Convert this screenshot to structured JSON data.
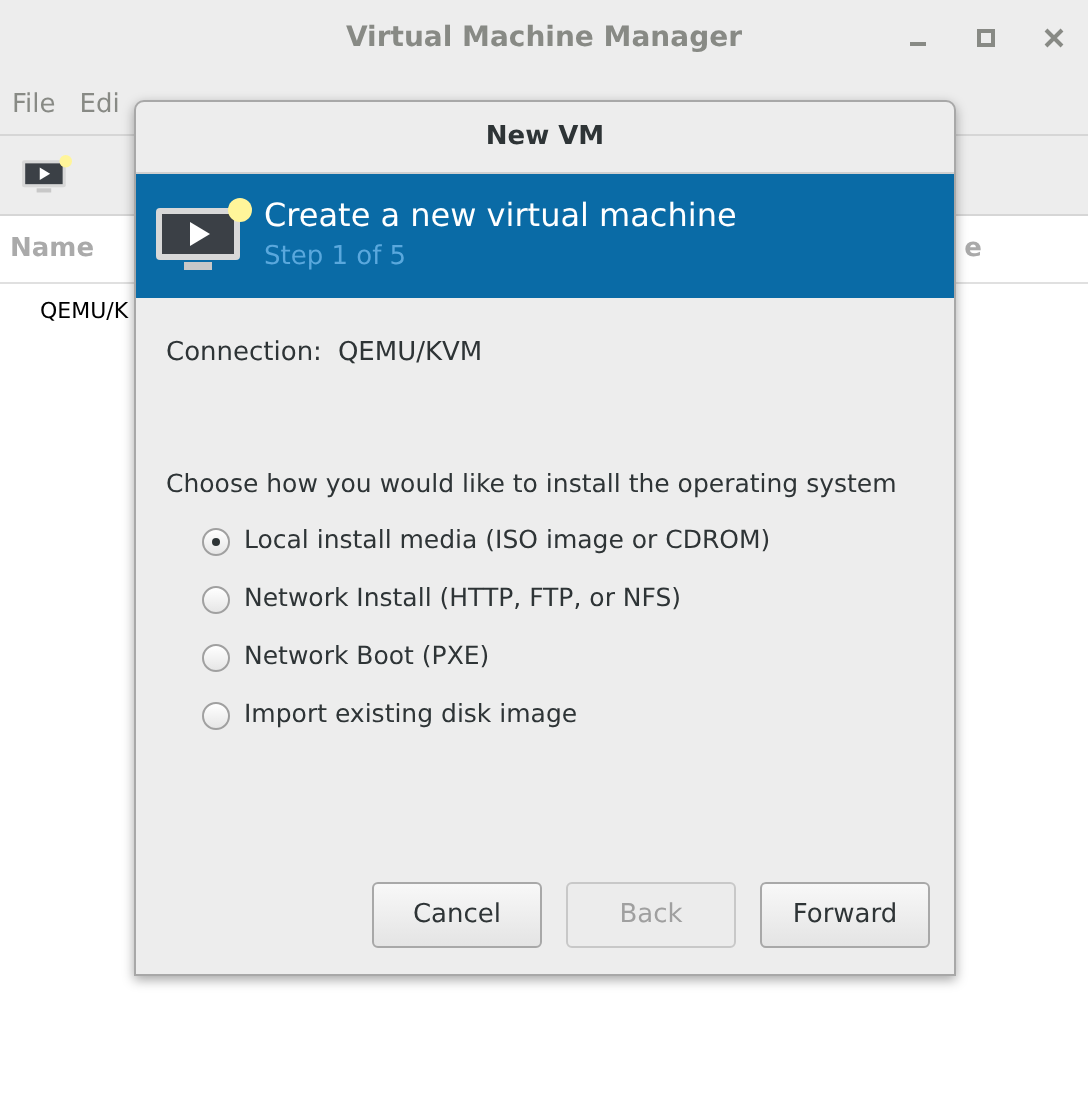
{
  "window": {
    "title": "Virtual Machine Manager"
  },
  "menu": [
    "File",
    "Edi"
  ],
  "table": {
    "columns": [
      "Name",
      "e"
    ],
    "rows": [
      "QEMU/K"
    ]
  },
  "dialog": {
    "title": "New VM",
    "heading": "Create a new virtual machine",
    "step": "Step 1 of 5",
    "connection_label": "Connection:",
    "connection_value": "QEMU/KVM",
    "prompt": "Choose how you would like to install the operating system",
    "options": [
      {
        "label": "Local install media (ISO image or CDROM)",
        "selected": true
      },
      {
        "label": "Network Install (HTTP, FTP, or NFS)",
        "selected": false
      },
      {
        "label": "Network Boot (PXE)",
        "selected": false
      },
      {
        "label": "Import existing disk image",
        "selected": false
      }
    ],
    "buttons": [
      {
        "label": "Cancel",
        "disabled": false
      },
      {
        "label": "Back",
        "disabled": true
      },
      {
        "label": "Forward",
        "disabled": false
      }
    ]
  }
}
